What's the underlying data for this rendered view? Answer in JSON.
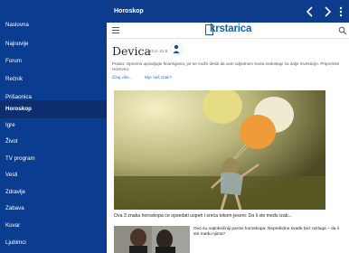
{
  "appbar": {
    "title": "Horoskop"
  },
  "drawer": {
    "items": [
      {
        "label": "Naslovna",
        "active": false
      },
      {
        "label": "Najnovije",
        "active": false
      },
      {
        "label": "Forum",
        "active": false
      },
      {
        "label": "Rečnik",
        "active": false
      },
      {
        "label": "Prišaonica",
        "active": false
      },
      {
        "label": "Horoskop",
        "active": true
      },
      {
        "label": "Igre",
        "active": false
      },
      {
        "label": "Život",
        "active": false
      },
      {
        "label": "TV program",
        "active": false
      },
      {
        "label": "Vesti",
        "active": false
      },
      {
        "label": "Zdravlje",
        "active": false
      },
      {
        "label": "Zabava",
        "active": false
      },
      {
        "label": "Kuvar",
        "active": false
      },
      {
        "label": "Ljubimci",
        "active": false
      }
    ]
  },
  "site": {
    "logo": "krstarica"
  },
  "sign": {
    "title": "Devica",
    "dates": "23.8.-22.9.",
    "intro": "Posao: Oprezno upravljajte finansijama, jer se može desiti da vam odjednom svota nedostaje za dalje investicije. Pripremite rezervno.",
    "read_more": "Čitaj više...",
    "other_sign": "Nije Vaš znak?"
  },
  "article": {
    "caption": "Ova 3 znaka horoskopa će opsedati uspeh i sreća tokom jeseni: Da li ste među izab...",
    "related": "Ovo su najtoksičniji parovi horoskopa: Neprekidne svađe bez razloga – da li ste među njima?"
  },
  "icons": {
    "back": "chevron-left-icon",
    "forward": "chevron-right-icon",
    "more": "more-vertical-icon",
    "hamburger": "hamburger-icon",
    "search": "search-icon",
    "sign": "virgo-icon"
  },
  "colors": {
    "drawer": "#0a3d8f",
    "drawer_active": "#0d2f70",
    "appbar": "#0d3c8c",
    "link": "#3b6fc0",
    "logo": "#0a5fb4"
  }
}
